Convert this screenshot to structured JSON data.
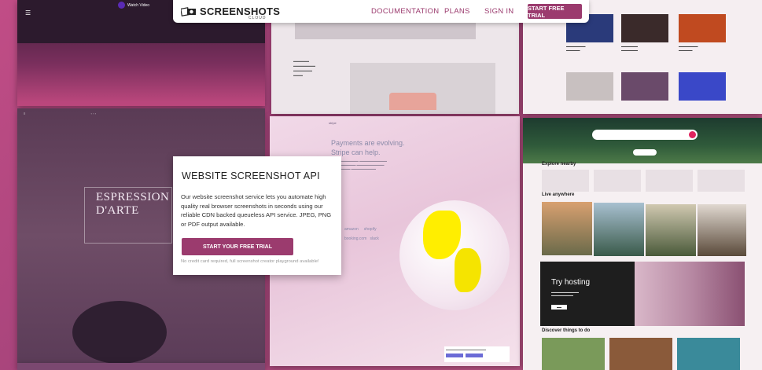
{
  "nav": {
    "logo_text": "SCREENSHOTS",
    "logo_sub": "CLOUD",
    "links": [
      "DOCUMENTATION",
      "PLANS",
      "SIGN IN"
    ],
    "cta": "START FREE TRIAL"
  },
  "hero": {
    "title": "WEBSITE SCREENSHOT API",
    "body": "Our website screenshot service lets you automate high quality real browser screenshots in seconds using our reliable CDN backed queueless API service. JPEG, PNG or PDF output available.",
    "cta": "START YOUR FREE TRIAL",
    "note": "No credit card required, full screenshot creator playground available!"
  },
  "tiles": {
    "music": {
      "watch_label": "Watch Video"
    },
    "espressione": {
      "title_line1": "ESPRESSION",
      "title_line2": "D'ARTE"
    },
    "stripe": {
      "nav": "stripe",
      "headline_line1": "Payments are evolving.",
      "headline_line2": "Stripe can help.",
      "logos": [
        "amazon",
        "shopify",
        "booking.com",
        "slack"
      ]
    },
    "airbnb": {
      "explore": "Explore nearby",
      "live": "Live anywhere",
      "hosting_title": "Try hosting",
      "discover": "Discover things to do"
    }
  },
  "colors": {
    "accent": "#9b3b6e",
    "background": "#b0467a"
  }
}
